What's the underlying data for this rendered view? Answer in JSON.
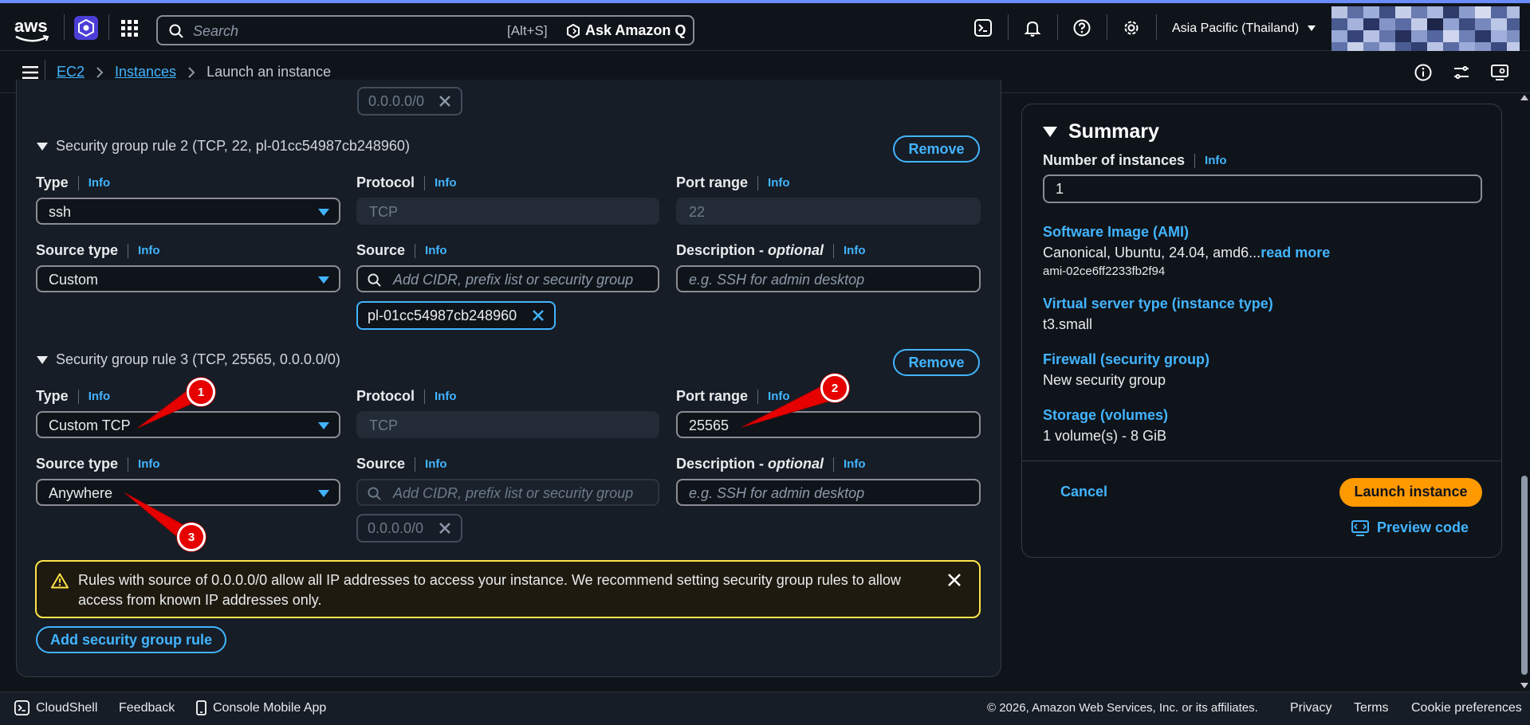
{
  "topbar": {
    "logo": "aws",
    "search_placeholder": "Search",
    "search_shortcut": "[Alt+S]",
    "ask_q": "Ask Amazon Q",
    "region": "Asia Pacific (Thailand)",
    "icons": [
      "cloudshell-icon",
      "bell-icon",
      "help-icon",
      "gear-icon"
    ]
  },
  "breadcrumb": {
    "items": [
      "EC2",
      "Instances"
    ],
    "current": "Launch an instance"
  },
  "rules": {
    "top_token": "0.0.0.0/0",
    "rule2": {
      "header": "Security group rule 2 (TCP, 22, pl-01cc54987cb248960)",
      "remove": "Remove",
      "type_label": "Type",
      "type_value": "ssh",
      "protocol_label": "Protocol",
      "protocol_value": "TCP",
      "port_label": "Port range",
      "port_value": "22",
      "source_type_label": "Source type",
      "source_type_value": "Custom",
      "source_label": "Source",
      "source_placeholder": "Add CIDR, prefix list or security group",
      "desc_label": "Description - ",
      "desc_optional": "optional",
      "desc_placeholder": "e.g. SSH for admin desktop",
      "token": "pl-01cc54987cb248960"
    },
    "rule3": {
      "header": "Security group rule 3 (TCP, 25565, 0.0.0.0/0)",
      "remove": "Remove",
      "type_label": "Type",
      "type_value": "Custom TCP",
      "protocol_label": "Protocol",
      "protocol_value": "TCP",
      "port_label": "Port range",
      "port_value": "25565",
      "source_type_label": "Source type",
      "source_type_value": "Anywhere",
      "source_label": "Source",
      "source_placeholder": "Add CIDR, prefix list or security group",
      "desc_label": "Description - ",
      "desc_optional": "optional",
      "desc_placeholder": "e.g. SSH for admin desktop",
      "token": "0.0.0.0/0"
    },
    "info": "Info",
    "warning": "Rules with source of 0.0.0.0/0 allow all IP addresses to access your instance. We recommend setting security group rules to allow access from known IP addresses only.",
    "add_rule": "Add security group rule"
  },
  "annotations": [
    "1",
    "2",
    "3"
  ],
  "summary": {
    "title": "Summary",
    "num_label": "Number of instances",
    "num_info": "Info",
    "num_value": "1",
    "ami_label": "Software Image (AMI)",
    "ami_value": "Canonical, Ubuntu, 24.04, amd6...",
    "ami_read_more": "read more",
    "ami_id": "ami-02ce6ff2233fb2f94",
    "type_label": "Virtual server type (instance type)",
    "type_value": "t3.small",
    "fw_label": "Firewall (security group)",
    "fw_value": "New security group",
    "storage_label": "Storage (volumes)",
    "storage_value": "1 volume(s) - 8 GiB",
    "cancel": "Cancel",
    "launch": "Launch instance",
    "preview": "Preview code"
  },
  "footer": {
    "cloudshell": "CloudShell",
    "feedback": "Feedback",
    "mobile": "Console Mobile App",
    "copyright": "© 2026, Amazon Web Services, Inc. or its affiliates.",
    "privacy": "Privacy",
    "terms": "Terms",
    "cookies": "Cookie preferences"
  },
  "colors": {
    "accent": "#42b4ff",
    "launch": "#ff9900",
    "warning": "#ffe347",
    "marker": "#e60000"
  }
}
